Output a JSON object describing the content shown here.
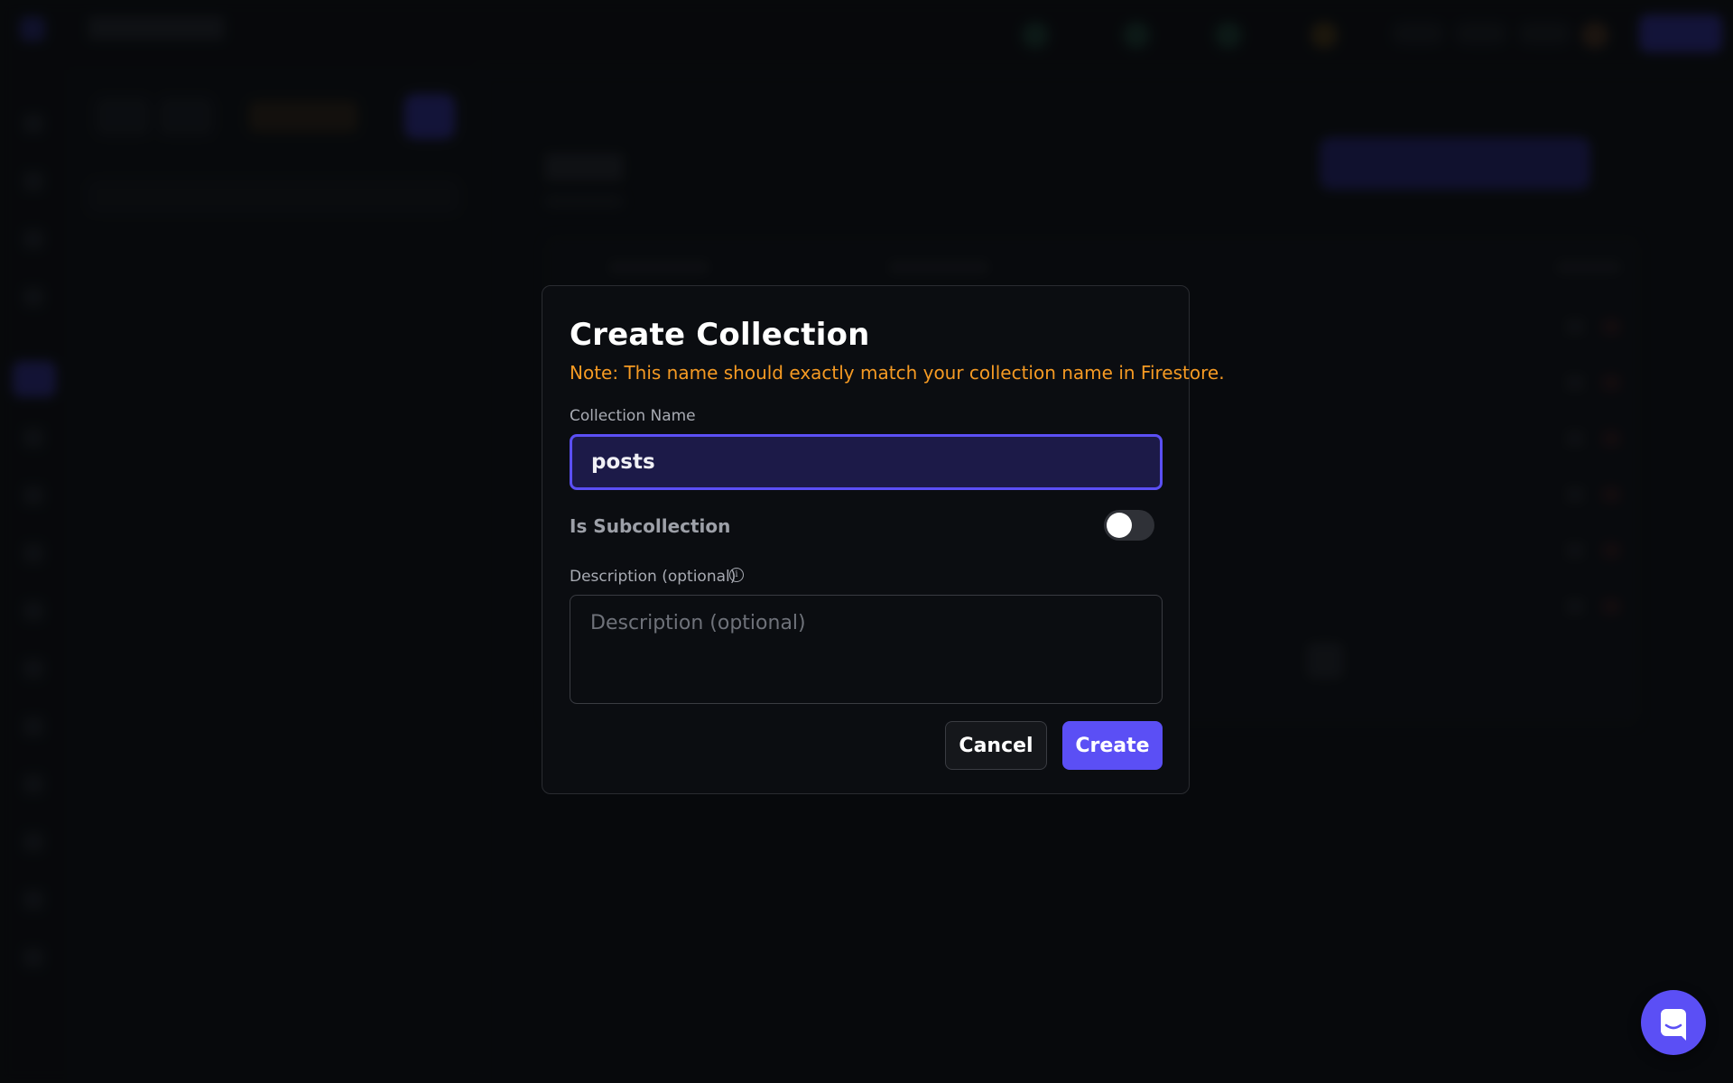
{
  "modal": {
    "title": "Create Collection",
    "note": "Note: This name should exactly match your collection name in Firestore.",
    "name_label": "Collection Name",
    "name_value": "posts",
    "subcollection_label": "Is Subcollection",
    "subcollection_enabled": false,
    "description_label": "Description (optional)",
    "description_placeholder": "Description (optional)",
    "description_value": "",
    "cancel_label": "Cancel",
    "create_label": "Create"
  },
  "icons": {
    "info": "info-icon",
    "chat": "chat-bubble-icon"
  },
  "colors": {
    "accent": "#5b4ff5",
    "note": "#f59a23",
    "background": "#0b0d10"
  }
}
